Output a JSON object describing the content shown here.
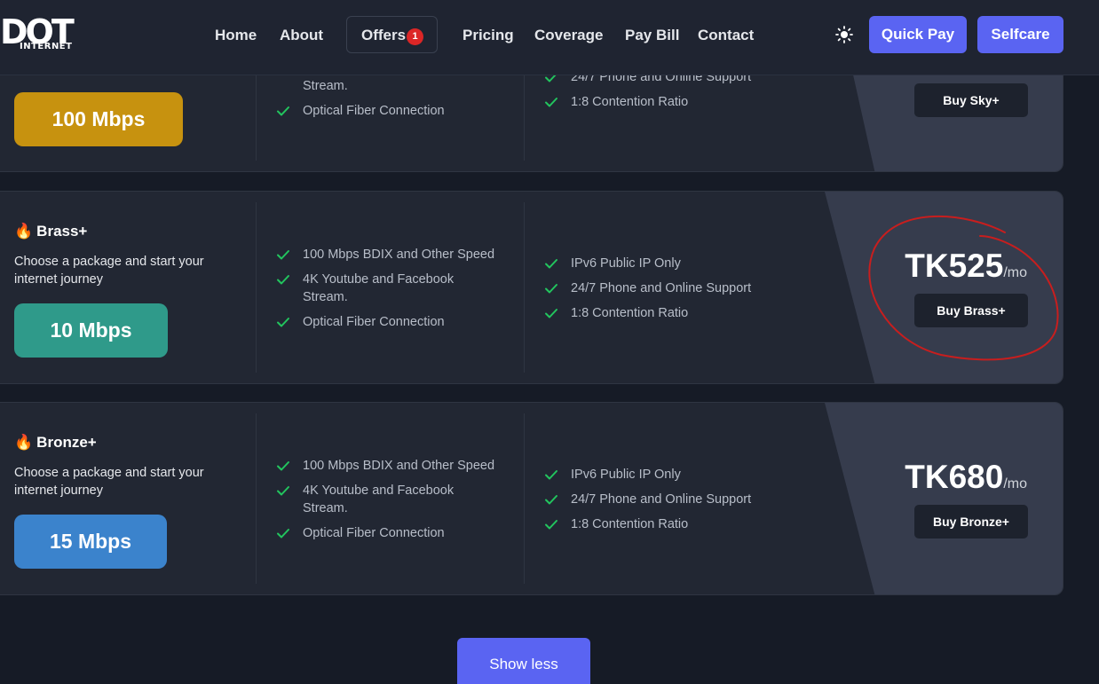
{
  "nav": {
    "logo_text": "DOT",
    "logo_sub": "INTERNET",
    "links": [
      "Home",
      "About",
      "Pricing",
      "Coverage",
      "Pay Bill",
      "Contact"
    ],
    "offers": {
      "label": "Offers",
      "count": "1"
    },
    "theme_icon": "sun-icon",
    "quick_pay": "Quick Pay",
    "selfcare": "Selfcare"
  },
  "plans": [
    {
      "name": "",
      "desc": "",
      "speed": "100 Mbps",
      "speed_color": "#c7920f",
      "features_left": [
        "Stream.",
        "Optical Fiber Connection"
      ],
      "features_right": [
        "24/7 Phone and Online Support",
        "1:8 Contention Ratio"
      ],
      "price": "",
      "per": "",
      "buy": "Buy Sky+"
    },
    {
      "name": "Brass+",
      "desc": "Choose a package and start your internet journey",
      "speed": "10 Mbps",
      "speed_color": "#2f9a8a",
      "features_left": [
        "100 Mbps BDIX and Other Speed",
        "4K Youtube and Facebook Stream.",
        "Optical Fiber Connection"
      ],
      "features_right": [
        "IPv6 Public IP Only",
        "24/7 Phone and Online Support",
        "1:8 Contention Ratio"
      ],
      "price": "TK525",
      "per": "/mo",
      "buy": "Buy Brass+"
    },
    {
      "name": "Bronze+",
      "desc": "Choose a package and start your internet journey",
      "speed": "15 Mbps",
      "speed_color": "#3b83cc",
      "features_left": [
        "100 Mbps BDIX and Other Speed",
        "4K Youtube and Facebook Stream.",
        "Optical Fiber Connection"
      ],
      "features_right": [
        "IPv6 Public IP Only",
        "24/7 Phone and Online Support",
        "1:8 Contention Ratio"
      ],
      "price": "TK680",
      "per": "/mo",
      "buy": "Buy Bronze+"
    }
  ],
  "show_less": "Show less",
  "colors": {
    "accent": "#5a64f2",
    "check": "#22c55e",
    "annotation": "#c81e1e",
    "badge": "#dc2626"
  }
}
